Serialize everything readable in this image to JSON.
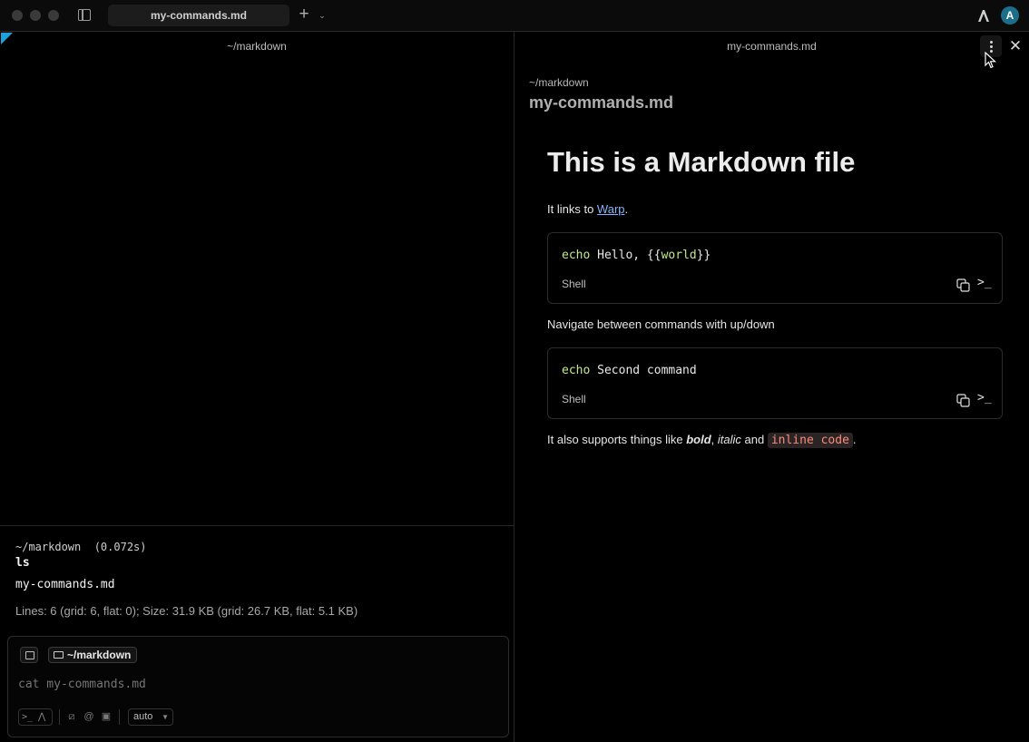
{
  "window": {
    "tab_title": "my-commands.md",
    "new_tab_symbol": "+",
    "tab_menu_symbol": "⌄",
    "avatar_initial": "A"
  },
  "left_pane": {
    "header": "~/markdown",
    "block": {
      "meta": "~/markdown  (0.072s)",
      "command": "ls",
      "output": "my-commands.md",
      "stats": "Lines: 6 (grid: 6, flat: 0); Size: 31.9 KB (grid: 26.7 KB, flat: 5.1 KB)"
    },
    "input": {
      "directory": "~/markdown",
      "placeholder": "cat my-commands.md",
      "mode_select": "auto"
    }
  },
  "right_pane": {
    "header": "my-commands.md",
    "doc_path": "~/markdown",
    "doc_name": "my-commands.md",
    "content": {
      "heading": "This is a Markdown file",
      "p1_prefix": "It links to ",
      "p1_link": "Warp",
      "p1_suffix": ".",
      "code1": {
        "kw": "echo",
        "text_a": " Hello, {{",
        "var": "world",
        "text_b": "}}",
        "lang": "Shell"
      },
      "p2": "Navigate between commands with up/down",
      "code2": {
        "kw": "echo",
        "text": " Second command",
        "lang": "Shell"
      },
      "p3_a": "It also supports things like ",
      "p3_bold": "bold",
      "p3_b": ", ",
      "p3_italic": "italic",
      "p3_c": " and ",
      "p3_code": "inline code",
      "p3_d": "."
    }
  },
  "colors": {
    "accent": "#1ea0d8",
    "link": "#8ab4f8",
    "keyword": "#c3e88d",
    "inline_code": "#ff8a7a"
  }
}
